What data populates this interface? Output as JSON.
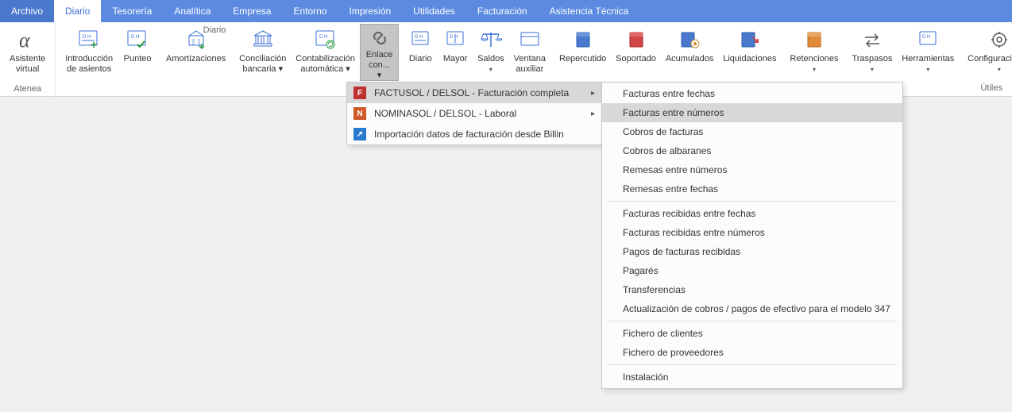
{
  "menubar": {
    "tabs": [
      {
        "label": "Archivo"
      },
      {
        "label": "Diario",
        "active": true
      },
      {
        "label": "Tesorería"
      },
      {
        "label": "Analítica"
      },
      {
        "label": "Empresa"
      },
      {
        "label": "Entorno"
      },
      {
        "label": "Impresión"
      },
      {
        "label": "Utilidades"
      },
      {
        "label": "Facturación"
      },
      {
        "label": "Asistencia Técnica"
      }
    ]
  },
  "ribbon": {
    "groups": {
      "atenea": {
        "label": "Atenea",
        "buttons": [
          {
            "label1": "Asistente",
            "label2": "virtual"
          }
        ]
      },
      "diario": {
        "label": "Diario",
        "buttons": [
          {
            "label1": "Introducción",
            "label2": "de asientos"
          },
          {
            "label1": "Punteo",
            "label2": ""
          },
          {
            "label1": "Amortizaciones",
            "label2": ""
          },
          {
            "label1": "Conciliación",
            "label2": "bancaria ▾"
          },
          {
            "label1": "Contabilización",
            "label2": "automática ▾"
          },
          {
            "label1": "Enlace",
            "label2": "con... ▾"
          },
          {
            "label1": "Diario",
            "label2": ""
          },
          {
            "label1": "Mayor",
            "label2": ""
          },
          {
            "label1": "Saldos",
            "label2": "▾"
          },
          {
            "label1": "Ventana",
            "label2": "auxiliar"
          },
          {
            "label1": "Repercutido",
            "label2": ""
          },
          {
            "label1": "Soportado",
            "label2": ""
          },
          {
            "label1": "Acumulados",
            "label2": ""
          },
          {
            "label1": "Liquidaciones",
            "label2": ""
          },
          {
            "label1": "Retenciones",
            "label2": "▾"
          },
          {
            "label1": "Traspasos",
            "label2": "▾"
          },
          {
            "label1": "Herramientas",
            "label2": "▾"
          },
          {
            "label1": "Configuraciones",
            "label2": "▾"
          }
        ]
      },
      "utiles": {
        "label": "Útiles"
      }
    }
  },
  "enlace_menu": {
    "items": [
      {
        "label": "FACTUSOL / DELSOL - Facturación completa",
        "icon": "F",
        "iconbg": "#c03030",
        "arrow": true,
        "hover": true
      },
      {
        "label": "NOMINASOL / DELSOL - Laboral",
        "icon": "N",
        "iconbg": "#d05a2a",
        "arrow": true
      },
      {
        "label": "Importación datos de facturación desde Billin",
        "icon": "↗",
        "iconbg": "#2a7bd0"
      }
    ]
  },
  "factusol_submenu": {
    "items": [
      {
        "label": "Facturas entre fechas"
      },
      {
        "label": "Facturas entre números",
        "hover": true
      },
      {
        "label": "Cobros de facturas"
      },
      {
        "label": "Cobros de albaranes"
      },
      {
        "label": "Remesas entre números"
      },
      {
        "label": "Remesas entre fechas"
      },
      {
        "sep": true
      },
      {
        "label": "Facturas recibidas entre fechas"
      },
      {
        "label": "Facturas recibidas entre números"
      },
      {
        "label": "Pagos de facturas recibidas"
      },
      {
        "label": "Pagarés"
      },
      {
        "label": "Transferencias"
      },
      {
        "label": "Actualización de cobros / pagos de efectivo para el modelo 347"
      },
      {
        "sep": true
      },
      {
        "label": "Fichero de clientes"
      },
      {
        "label": "Fichero de proveedores"
      },
      {
        "sep": true
      },
      {
        "label": "Instalación"
      }
    ]
  }
}
